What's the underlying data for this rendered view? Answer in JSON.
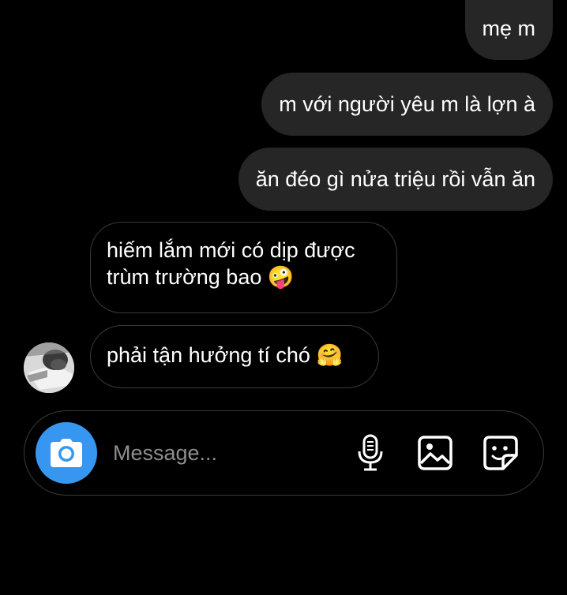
{
  "messages": {
    "outgoing": [
      {
        "text": "mẹ m"
      },
      {
        "text": "m với người yêu m là lợn à"
      },
      {
        "text": "ăn đéo gì nửa triệu rồi vẫn ăn"
      }
    ],
    "incoming": [
      {
        "line1": "hiếm lắm mới có dịp được",
        "line2": "trùm trường bao",
        "emoji": "🤪"
      },
      {
        "line1": "phải tận hưởng tí chó",
        "emoji": "🤗"
      }
    ]
  },
  "composer": {
    "placeholder": "Message...",
    "icons": [
      "camera-icon",
      "microphone-icon",
      "gallery-icon",
      "sticker-icon"
    ]
  },
  "colors": {
    "background": "#000000",
    "outgoing_bubble": "#262626",
    "incoming_border": "#3a3a3a",
    "camera_button": "#3797f0",
    "placeholder": "#8e8e8e"
  }
}
